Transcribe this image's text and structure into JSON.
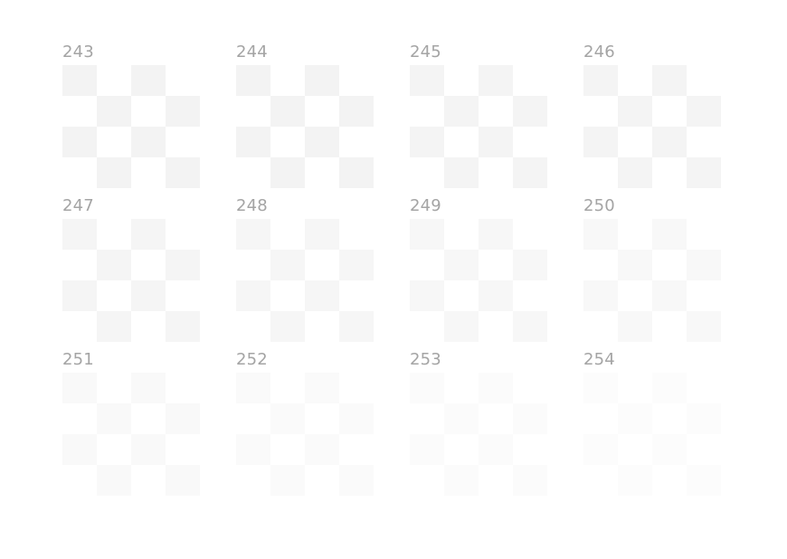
{
  "panels": [
    {
      "label": "243",
      "color": "#f3f3f3"
    },
    {
      "label": "244",
      "color": "#f3f3f3"
    },
    {
      "label": "245",
      "color": "#f4f4f4"
    },
    {
      "label": "246",
      "color": "#f4f4f4"
    },
    {
      "label": "247",
      "color": "#f5f5f5"
    },
    {
      "label": "248",
      "color": "#f6f6f6"
    },
    {
      "label": "249",
      "color": "#f7f7f7"
    },
    {
      "label": "250",
      "color": "#f8f8f8"
    },
    {
      "label": "251",
      "color": "#f9f9f9"
    },
    {
      "label": "252",
      "color": "#fafafa"
    },
    {
      "label": "253",
      "color": "#fbfbfb"
    },
    {
      "label": "254",
      "color": "#fcfcfc"
    }
  ]
}
